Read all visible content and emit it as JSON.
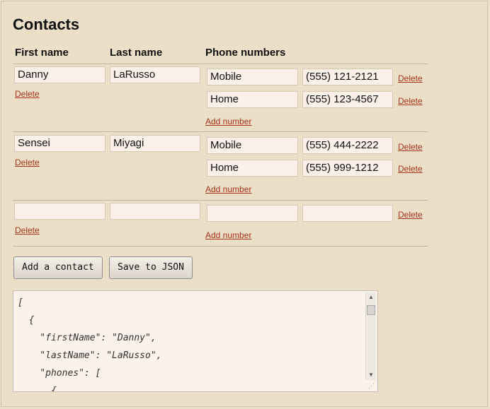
{
  "page": {
    "title": "Contacts"
  },
  "headers": {
    "first_name": "First name",
    "last_name": "Last name",
    "phones": "Phone numbers"
  },
  "links": {
    "delete": "Delete",
    "add_number": "Add number"
  },
  "contacts": [
    {
      "first": "Danny",
      "last": "LaRusso",
      "phones": [
        {
          "type": "Mobile",
          "number": "(555) 121-2121"
        },
        {
          "type": "Home",
          "number": "(555) 123-4567"
        }
      ]
    },
    {
      "first": "Sensei",
      "last": "Miyagi",
      "phones": [
        {
          "type": "Mobile",
          "number": "(555) 444-2222"
        },
        {
          "type": "Home",
          "number": "(555) 999-1212"
        }
      ]
    },
    {
      "first": "",
      "last": "",
      "phones": [
        {
          "type": "",
          "number": ""
        }
      ]
    }
  ],
  "buttons": {
    "add_contact": "Add a contact",
    "save_json": "Save to JSON"
  },
  "json_output": "[\n  {\n    \"firstName\": \"Danny\",\n    \"lastName\": \"LaRusso\",\n    \"phones\": [\n      {"
}
